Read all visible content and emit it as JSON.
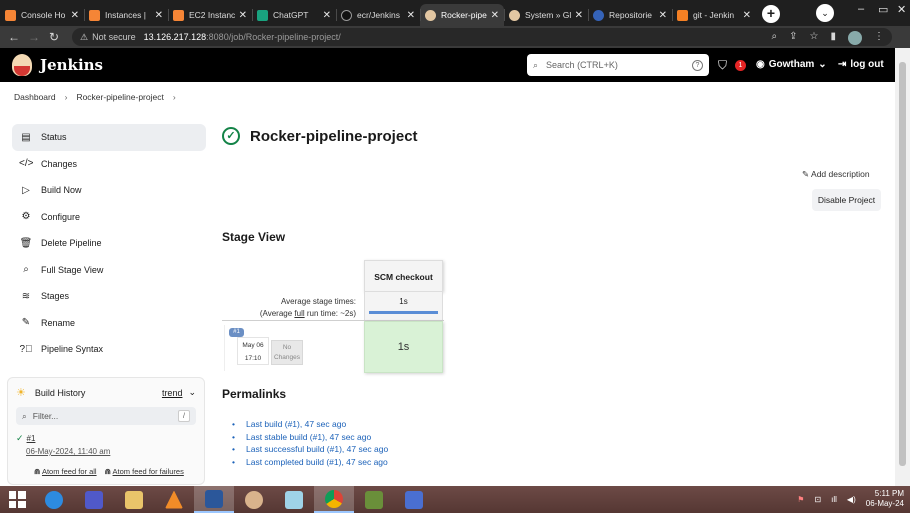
{
  "browser": {
    "tabs": [
      {
        "title": "Console Ho",
        "color": "#f58536",
        "active": false
      },
      {
        "title": "Instances |",
        "color": "#f58536",
        "active": false
      },
      {
        "title": "EC2 Instanc",
        "color": "#f58536",
        "active": false
      },
      {
        "title": "ChatGPT",
        "color": "#19a37f",
        "active": false
      },
      {
        "title": "ecr/Jenkins",
        "color": "#111111",
        "active": false
      },
      {
        "title": "Rocker-pipe",
        "color": "#e3c7a2",
        "active": true
      },
      {
        "title": "System » Gl",
        "color": "#e3c7a2",
        "active": false
      },
      {
        "title": "Repositorie",
        "color": "#3563b8",
        "active": false
      },
      {
        "title": "git - Jenkin",
        "color": "#f48024",
        "active": false
      }
    ],
    "address": {
      "security": "Not secure",
      "host": "13.126.217.128",
      "path": ":8080/job/Rocker-pipeline-project/"
    }
  },
  "header": {
    "app_title": "Jenkins",
    "search_placeholder": "Search (CTRL+K)",
    "notification_count": "1",
    "user": "Gowtham",
    "logout": "log out"
  },
  "breadcrumb": {
    "dashboard": "Dashboard",
    "project": "Rocker-pipeline-project"
  },
  "sidebar": {
    "items": [
      {
        "label": "Status",
        "icon": "status-icon"
      },
      {
        "label": "Changes",
        "icon": "code-icon"
      },
      {
        "label": "Build Now",
        "icon": "play-icon"
      },
      {
        "label": "Configure",
        "icon": "gear-icon"
      },
      {
        "label": "Delete Pipeline",
        "icon": "trash-icon"
      },
      {
        "label": "Full Stage View",
        "icon": "search-icon"
      },
      {
        "label": "Stages",
        "icon": "layers-icon"
      },
      {
        "label": "Rename",
        "icon": "pencil-icon"
      },
      {
        "label": "Pipeline Syntax",
        "icon": "help-icon"
      }
    ]
  },
  "build_history": {
    "title": "Build History",
    "trend": "trend",
    "filter_placeholder": "Filter...",
    "filter_shortcut": "/",
    "builds": [
      {
        "number": "#1",
        "date": "06-May-2024, 11:40 am",
        "status": "success"
      }
    ],
    "feed_all": "Atom feed for all",
    "feed_failures": "Atom feed for failures"
  },
  "main": {
    "title": "Rocker-pipeline-project",
    "add_description": "Add description",
    "disable_project": "Disable Project",
    "stage_view_title": "Stage View",
    "stage_view": {
      "stage_name": "SCM checkout",
      "avg_label": "Average stage times:",
      "avg_runtime_prefix": "(Average ",
      "avg_runtime_link": "full",
      "avg_runtime_suffix": " run time: ~2s)",
      "avg_stage_time": "1s",
      "run": {
        "tag": "#1",
        "date": "May 06",
        "time": "17:10",
        "changes": "No Changes",
        "stage_time": "1s"
      }
    },
    "permalinks_title": "Permalinks",
    "permalinks": [
      "Last build (#1), 47 sec ago",
      "Last stable build (#1), 47 sec ago",
      "Last successful build (#1), 47 sec ago",
      "Last completed build (#1), 47 sec ago"
    ]
  },
  "taskbar": {
    "time": "5:11 PM",
    "date": "06-May-24"
  }
}
